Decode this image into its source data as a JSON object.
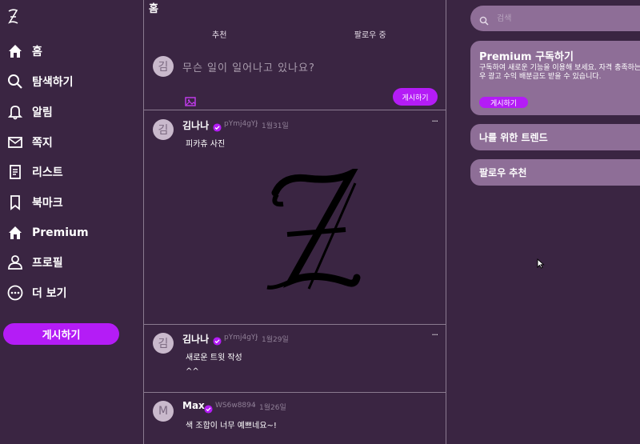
{
  "sidebar": {
    "logo": "logo-icon",
    "items": [
      {
        "label": "홈",
        "icon": "home-icon"
      },
      {
        "label": "탐색하기",
        "icon": "search-icon"
      },
      {
        "label": "알림",
        "icon": "bell-icon"
      },
      {
        "label": "쪽지",
        "icon": "mail-icon"
      },
      {
        "label": "리스트",
        "icon": "list-icon"
      },
      {
        "label": "북마크",
        "icon": "bookmark-icon"
      },
      {
        "label": "Premium",
        "icon": "premium-icon"
      },
      {
        "label": "프로필",
        "icon": "user-icon"
      },
      {
        "label": "더 보기",
        "icon": "more-icon"
      }
    ],
    "post_button": "게시하기"
  },
  "main": {
    "title": "홈",
    "tabs": [
      "추천",
      "팔로우 중"
    ],
    "compose": {
      "avatar": "김",
      "placeholder": "무슨 일이 일어나고 있나요?",
      "button": "게시하기"
    },
    "tweets": [
      {
        "avatar": "김",
        "name": "김나나",
        "handle": "pYmj4gYJ",
        "date": "1월31일",
        "more": "···",
        "lines": [
          "피카츄 사진"
        ]
      },
      {
        "avatar": "김",
        "name": "김나나",
        "handle": "pYmj4gYJ",
        "date": "1월29일",
        "more": "···",
        "lines": [
          "새로운 트윗 작성",
          "^^"
        ]
      },
      {
        "avatar": "M",
        "name": "Max",
        "handle": "WS6w8894",
        "date": "1월26일",
        "more": "",
        "lines": [
          "색 조합이 너무 예쁘네요~!"
        ]
      }
    ]
  },
  "right": {
    "search_placeholder": "검색",
    "premium": {
      "title": "Premium 구독하기",
      "desc": "구독하여 새로운 기능을 이용해 보세요. 자격 충족하는 경우 광고 수익 배분금도 받을 수 있습니다.",
      "button": "게시하기"
    },
    "trends_title": "나를 위한 트렌드",
    "follow_title": "팔로우 추천"
  },
  "colors": {
    "background": "#3a2542",
    "accent": "#b41cf6",
    "card": "#8e6e97",
    "avatar": "#c9b9cc"
  }
}
